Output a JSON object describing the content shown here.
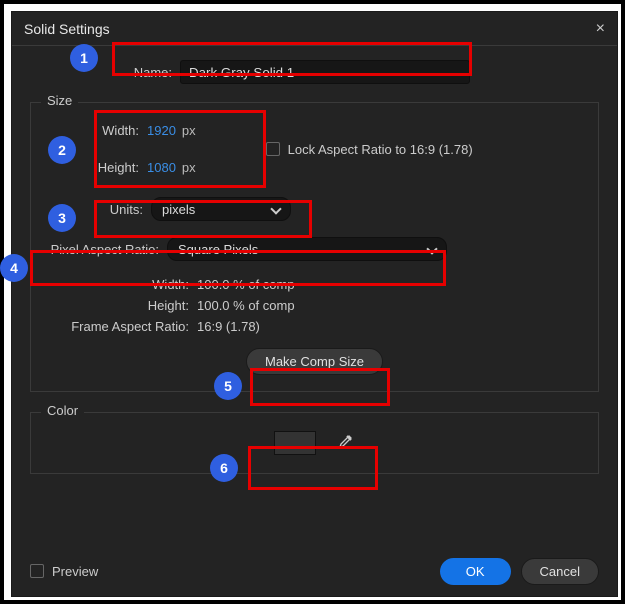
{
  "dialog": {
    "title": "Solid Settings",
    "close_icon": "×"
  },
  "name": {
    "label": "Name:",
    "value": "Dark Gray Solid 1"
  },
  "size": {
    "legend": "Size",
    "width_label": "Width:",
    "width_value": "1920",
    "height_label": "Height:",
    "height_value": "1080",
    "px_suffix": "px",
    "lock_label": "Lock Aspect Ratio to 16:9 (1.78)",
    "units_label": "Units:",
    "units_value": "pixels",
    "par_label": "Pixel Aspect Ratio:",
    "par_value": "Square Pixels",
    "info_width_label": "Width:",
    "info_width_value": "100.0 % of comp",
    "info_height_label": "Height:",
    "info_height_value": "100.0 % of comp",
    "info_far_label": "Frame Aspect Ratio:",
    "info_far_value": "16:9 (1.78)",
    "make_comp_label": "Make Comp Size"
  },
  "color": {
    "legend": "Color",
    "swatch_hex": "#333333"
  },
  "footer": {
    "preview_label": "Preview",
    "ok_label": "OK",
    "cancel_label": "Cancel"
  },
  "annotations": {
    "n1": "1",
    "n2": "2",
    "n3": "3",
    "n4": "4",
    "n5": "5",
    "n6": "6"
  }
}
